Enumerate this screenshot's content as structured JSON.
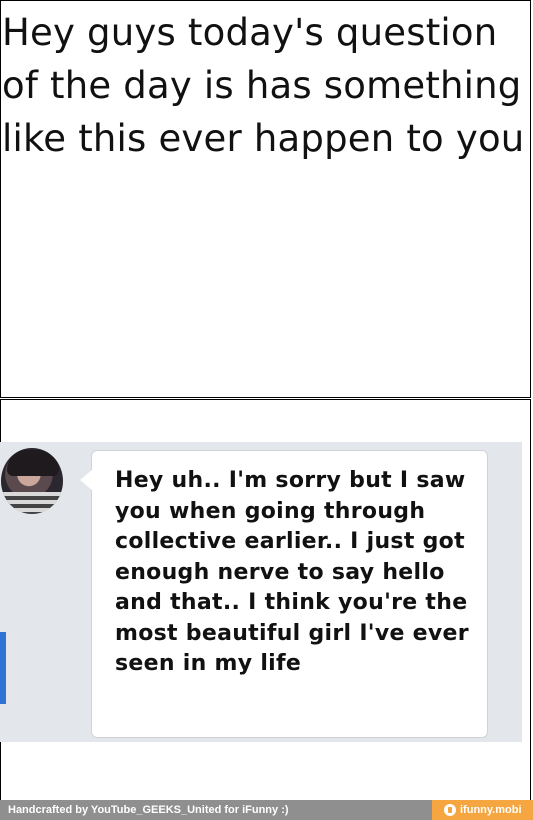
{
  "meme": {
    "top_panel_text": "Hey guys today's question of the day is has something like this ever happen to you",
    "chat": {
      "message": "Hey uh.. I'm sorry but I saw you when going through collective earlier.. I just got enough nerve to say hello and that.. I think you're the most beautiful girl I've ever seen in my life",
      "bubble_color": "#ffffff",
      "background_color": "#e3e6ea"
    }
  },
  "footer": {
    "credit": "Handcrafted by YouTube_GEEKS_United for iFunny :)",
    "brand": "ifunny.mobi",
    "brand_color": "#f5a640"
  }
}
